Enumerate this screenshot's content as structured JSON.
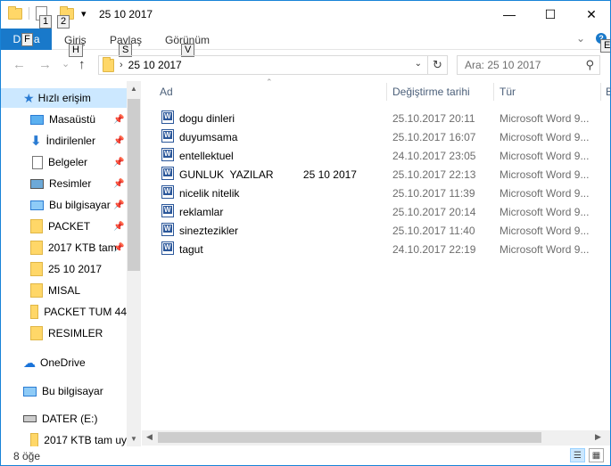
{
  "window": {
    "title": "25 10 2017",
    "minimize": "—",
    "maximize": "☐",
    "close": "✕"
  },
  "qat": {
    "keytip_1": "1",
    "keytip_2": "2",
    "dropdown": "▾"
  },
  "ribbon": {
    "file_label_a": "D",
    "file_keytip": "F",
    "file_label_b": "a",
    "tabs": [
      {
        "label": "Giriş",
        "keytip": "H"
      },
      {
        "label": "Paylaş",
        "keytip": "S"
      },
      {
        "label": "Görünüm",
        "keytip": "V"
      }
    ],
    "collapse_chevron": "⌄",
    "help_keytip": "E",
    "help_icon": "?"
  },
  "nav": {
    "back": "←",
    "forward": "→",
    "recent": "⌄",
    "up": "↑",
    "breadcrumb_sep": "›",
    "path": "25 10 2017",
    "path_dropdown": "⌄",
    "refresh": "↻",
    "search_placeholder": "Ara: 25 10 2017",
    "search_icon": "⚲"
  },
  "sidebar": {
    "items": [
      {
        "label": "Hızlı erişim",
        "icon": "star-icon",
        "pinned": false
      },
      {
        "label": "Masaüstü",
        "icon": "desktop-icon",
        "pinned": true
      },
      {
        "label": "İndirilenler",
        "icon": "downloads-icon",
        "pinned": true
      },
      {
        "label": "Belgeler",
        "icon": "documents-icon",
        "pinned": true
      },
      {
        "label": "Resimler",
        "icon": "pictures-icon",
        "pinned": true
      },
      {
        "label": "Bu bilgisayar",
        "icon": "computer-icon",
        "pinned": true
      },
      {
        "label": "PACKET",
        "icon": "folder-icon",
        "pinned": true
      },
      {
        "label": "2017 KTB tam",
        "icon": "folder-icon",
        "pinned": true
      },
      {
        "label": "25 10 2017",
        "icon": "folder-icon",
        "pinned": false
      },
      {
        "label": "MISAL",
        "icon": "folder-icon",
        "pinned": false
      },
      {
        "label": "PACKET TUM 44",
        "icon": "folder-icon",
        "pinned": false
      },
      {
        "label": "RESIMLER",
        "icon": "folder-icon",
        "pinned": false
      },
      {
        "label": "OneDrive",
        "icon": "cloud-icon",
        "pinned": false
      },
      {
        "label": "Bu bilgisayar",
        "icon": "computer-icon",
        "pinned": false
      },
      {
        "label": "DATER (E:)",
        "icon": "drive-icon",
        "pinned": false
      },
      {
        "label": "2017 KTB tam uy",
        "icon": "folder-icon",
        "pinned": false
      }
    ],
    "pin_glyph": "📌",
    "scroll_up": "▲",
    "scroll_down": "▼"
  },
  "columns": {
    "name": "Ad",
    "modified": "Değiştirme tarihi",
    "type": "Tür",
    "size": "B",
    "sort_glyph": "⌃"
  },
  "files": [
    {
      "name": "dogu dinleri",
      "modified": "25.10.2017 20:11",
      "type": "Microsoft Word 9..."
    },
    {
      "name": "duyumsama",
      "modified": "25.10.2017 16:07",
      "type": "Microsoft Word 9..."
    },
    {
      "name": "entellektuel",
      "modified": "24.10.2017 23:05",
      "type": "Microsoft Word 9..."
    },
    {
      "name": "GUNLUK  YAZILAR          25 10 2017",
      "modified": "25.10.2017 22:13",
      "type": "Microsoft Word 9..."
    },
    {
      "name": "nicelik nitelik",
      "modified": "25.10.2017 11:39",
      "type": "Microsoft Word 9..."
    },
    {
      "name": "reklamlar",
      "modified": "25.10.2017 20:14",
      "type": "Microsoft Word 9..."
    },
    {
      "name": "sineztezikler",
      "modified": "25.10.2017 11:40",
      "type": "Microsoft Word 9..."
    },
    {
      "name": "tagut",
      "modified": "24.10.2017 22:19",
      "type": "Microsoft Word 9..."
    }
  ],
  "hscroll": {
    "left": "◀",
    "right": "▶"
  },
  "status": {
    "count": "8 öğe",
    "details_view": "☰",
    "icons_view": "▦"
  }
}
